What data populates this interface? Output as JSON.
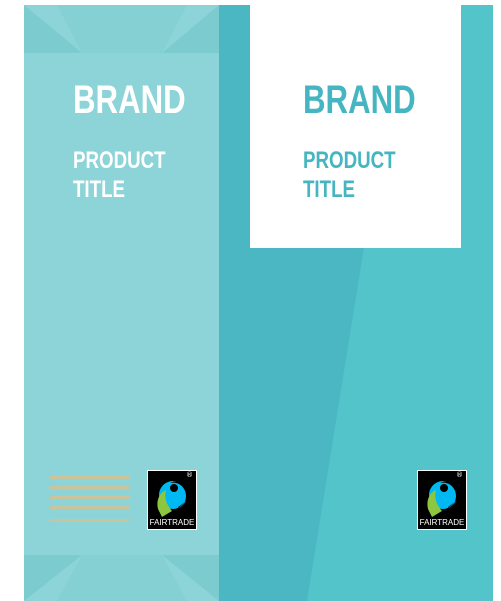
{
  "packaging": {
    "left_face": {
      "brand": "BRAND",
      "product_line1": "PRODUCT",
      "product_line2": "TITLE",
      "text_color": "#ffffff",
      "background_color": "#84d0d3"
    },
    "right_face": {
      "brand": "BRAND",
      "product_line1": "PRODUCT",
      "product_line2": "TITLE",
      "text_color": "#45b6c1",
      "background_color": "#4ab7c3",
      "label_background": "#ffffff"
    },
    "certification": {
      "logo_text": "FAIRTRADE",
      "registered_mark": "®",
      "icon": "fairtrade-icon",
      "colors": {
        "blue": "#00b9f2",
        "green": "#8dc63f",
        "black": "#000000"
      }
    },
    "decor": {
      "stripe_color": "#c9c49d",
      "stripe_count": 5
    }
  }
}
